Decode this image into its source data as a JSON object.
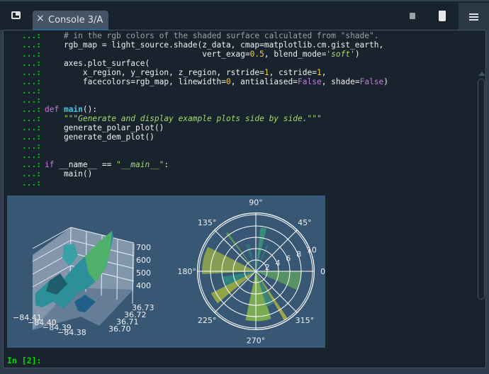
{
  "tab": {
    "label": "Console 3/A",
    "close": "×"
  },
  "prompt_cont": "...:",
  "code_lines": [
    [
      {
        "t": "    # in the rgb colors of the shaded surface calculated from \"shade\".",
        "c": "cm"
      }
    ],
    [
      {
        "t": "    rgb_map = light_source.shade(z_data, cmap=matplotlib.cm.gist_earth,",
        "c": ""
      }
    ],
    [
      {
        "t": "                                 vert_exag=",
        "c": ""
      },
      {
        "t": "0.5",
        "c": "num"
      },
      {
        "t": ", blend_mode=",
        "c": ""
      },
      {
        "t": "'soft'",
        "c": "str"
      },
      {
        "t": ")",
        "c": ""
      }
    ],
    [
      {
        "t": "    axes.plot_surface(",
        "c": ""
      }
    ],
    [
      {
        "t": "        x_region, y_region, z_region, rstride=",
        "c": ""
      },
      {
        "t": "1",
        "c": "num"
      },
      {
        "t": ", cstride=",
        "c": ""
      },
      {
        "t": "1",
        "c": "num"
      },
      {
        "t": ",",
        "c": ""
      }
    ],
    [
      {
        "t": "        facecolors=rgb_map, linewidth=",
        "c": ""
      },
      {
        "t": "0",
        "c": "num"
      },
      {
        "t": ", antialiased=",
        "c": ""
      },
      {
        "t": "False",
        "c": "kwv"
      },
      {
        "t": ", shade=",
        "c": ""
      },
      {
        "t": "False",
        "c": "kwv"
      },
      {
        "t": ")",
        "c": ""
      }
    ],
    [],
    [],
    [
      {
        "t": "def ",
        "c": "kw"
      },
      {
        "t": "main",
        "c": "fn"
      },
      {
        "t": "():",
        "c": ""
      }
    ],
    [
      {
        "t": "    \"\"\"",
        "c": "str"
      },
      {
        "t": "Generate and display example plots side by side.",
        "c": "str"
      },
      {
        "t": "\"\"\"",
        "c": "str"
      }
    ],
    [
      {
        "t": "    generate_polar_plot()",
        "c": ""
      }
    ],
    [
      {
        "t": "    generate_dem_plot()",
        "c": ""
      }
    ],
    [],
    [],
    [
      {
        "t": "if ",
        "c": "kw"
      },
      {
        "t": "__name__ == ",
        "c": ""
      },
      {
        "t": "\"__main__\"",
        "c": "str"
      },
      {
        "t": ":",
        "c": ""
      }
    ],
    [
      {
        "t": "    main()",
        "c": ""
      }
    ],
    []
  ],
  "input_prompt": "In [2]:",
  "chart_data": [
    {
      "type": "surface3d",
      "title": "",
      "x_ticks": [
        "−84.41",
        "−84.40",
        "−84.39",
        "−84.38"
      ],
      "y_ticks": [
        "36.70",
        "36.71",
        "36.72",
        "36.73"
      ],
      "z_ticks": [
        "400",
        "500",
        "600",
        "700"
      ],
      "zlim": [
        380,
        740
      ],
      "colormap": "gist_earth shaded"
    },
    {
      "type": "polar-bar",
      "angle_ticks": [
        "0°",
        "45°",
        "90°",
        "135°",
        "180°",
        "225°",
        "270°",
        "315°"
      ],
      "radial_ticks": [
        "2",
        "4",
        "6",
        "8",
        "10"
      ],
      "rlim": [
        0,
        10.3
      ],
      "bars": [
        {
          "theta": -12,
          "width": 25,
          "r": 8.0,
          "color": "#5fa060"
        },
        {
          "theta": 168,
          "width": 30,
          "r": 9.5,
          "color": "#9ab04a"
        },
        {
          "theta": 198,
          "width": 18,
          "r": 6.0,
          "color": "#2f8f7f"
        },
        {
          "theta": 213,
          "width": 14,
          "r": 8.8,
          "color": "#a8b840"
        },
        {
          "theta": 273,
          "width": 30,
          "r": 8.8,
          "color": "#8cc048"
        },
        {
          "theta": 293,
          "width": 14,
          "r": 6.5,
          "color": "#3d8f78"
        },
        {
          "theta": 302,
          "width": 4,
          "r": 10.0,
          "color": "#b8b840"
        },
        {
          "theta": 80,
          "width": 8,
          "r": 7.8,
          "color": "#3a9a78"
        },
        {
          "theta": 127,
          "width": 3,
          "r": 8.5,
          "color": "#60a050"
        },
        {
          "theta": 107,
          "width": 8,
          "r": 5.0,
          "color": "#2a7a80"
        },
        {
          "theta": 66,
          "width": 3,
          "r": 5.0,
          "color": "#2a8a80"
        }
      ]
    }
  ]
}
